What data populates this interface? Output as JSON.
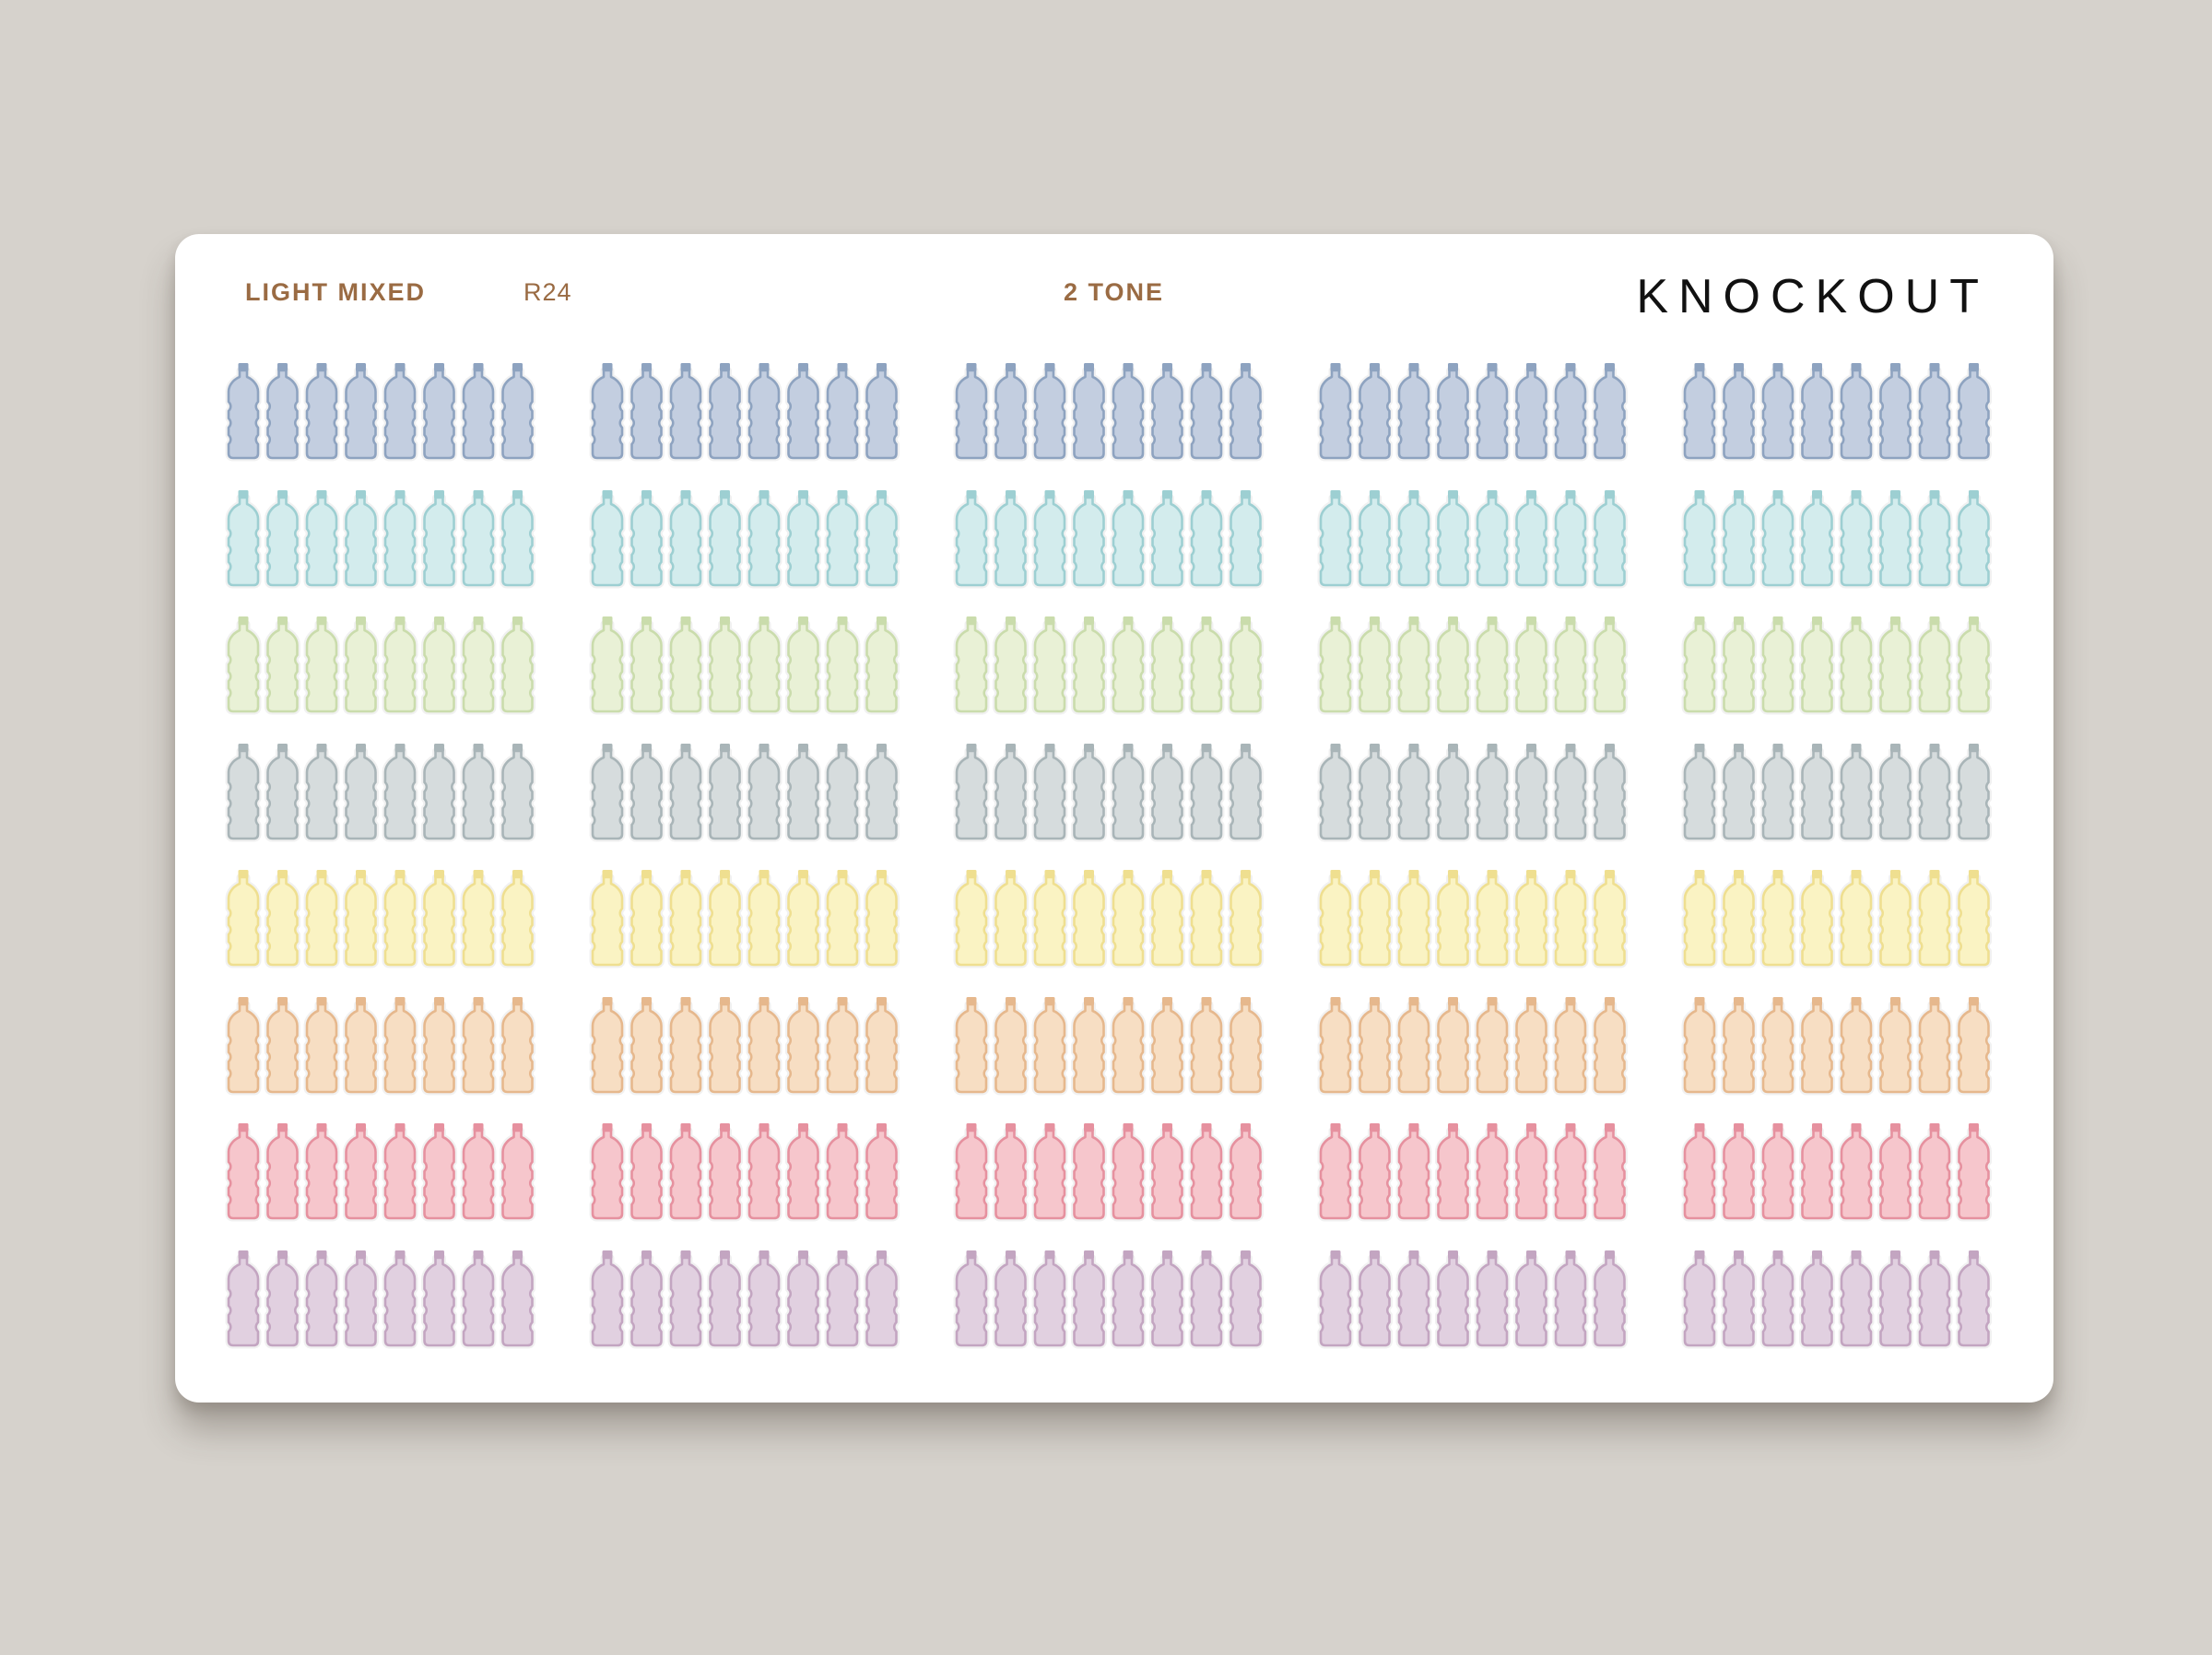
{
  "sheet": {
    "header": {
      "collection": "LIGHT MIXED",
      "code": "R24",
      "style": "2 TONE",
      "brand": "KNOCKOUT"
    },
    "colors": {
      "background": "#d6d2cc",
      "sheet": "#ffffff",
      "header_text": "#9a6b43",
      "brand_text": "#111111"
    },
    "icon": "water-bottle-icon",
    "bottles_per_strip": 8,
    "strips_per_row": 5,
    "rows": [
      {
        "color": "blue",
        "fill": "#c3cee0",
        "outline": "#8ea3c0",
        "cap": "#8ea3c0"
      },
      {
        "color": "aqua",
        "fill": "#d3eced",
        "outline": "#9dcfd2",
        "cap": "#9dcfd2"
      },
      {
        "color": "green",
        "fill": "#e9f1d6",
        "outline": "#cadcac",
        "cap": "#cadcac"
      },
      {
        "color": "gray",
        "fill": "#d6dcdd",
        "outline": "#a9b5b8",
        "cap": "#a9b5b8"
      },
      {
        "color": "yellow",
        "fill": "#faf3c3",
        "outline": "#efdf90",
        "cap": "#efdf90"
      },
      {
        "color": "peach",
        "fill": "#f7dec3",
        "outline": "#e6b88d",
        "cap": "#e6b88d"
      },
      {
        "color": "pink",
        "fill": "#f6c6cc",
        "outline": "#e6919f",
        "cap": "#e6919f"
      },
      {
        "color": "lilac",
        "fill": "#e1d0e0",
        "outline": "#c3a5c1",
        "cap": "#c3a5c1"
      }
    ]
  }
}
